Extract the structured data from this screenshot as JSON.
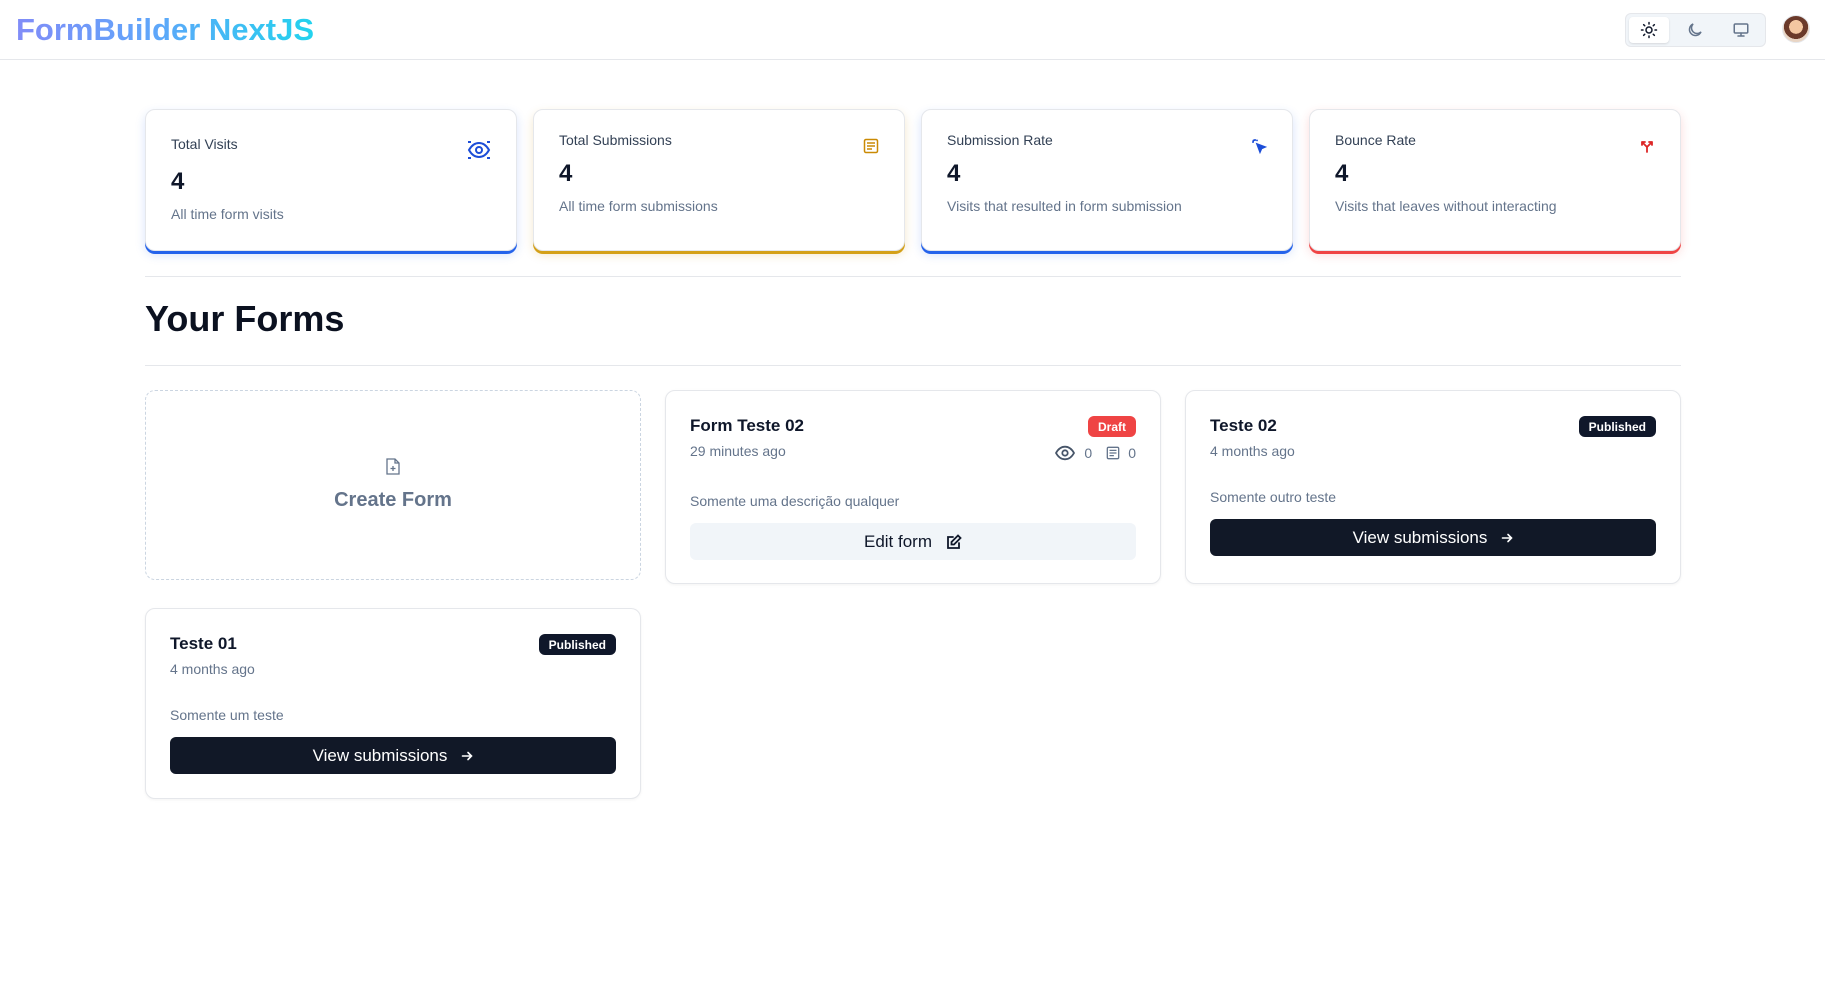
{
  "header": {
    "logo": "FormBuilder NextJS",
    "theme_options": [
      "light-theme",
      "dark-theme",
      "system-theme"
    ]
  },
  "stats": [
    {
      "title": "Total Visits",
      "value": "4",
      "helper": "All time form visits",
      "icon": "eye-icon",
      "color": "#2563eb"
    },
    {
      "title": "Total Submissions",
      "value": "4",
      "helper": "All time form submissions",
      "icon": "form-icon",
      "color": "#ca8a04"
    },
    {
      "title": "Submission Rate",
      "value": "4",
      "helper": "Visits that resulted in form submission",
      "icon": "cursor-click-icon",
      "color": "#2563eb"
    },
    {
      "title": "Bounce Rate",
      "value": "4",
      "helper": "Visits that leaves without interacting",
      "icon": "split-arrow-icon",
      "color": "#dc2626"
    }
  ],
  "section": {
    "title": "Your Forms"
  },
  "create_card": {
    "label": "Create Form"
  },
  "forms": [
    {
      "name": "Form Teste 02",
      "time": "29 minutes ago",
      "status": "Draft",
      "visits": "0",
      "submissions": "0",
      "description": "Somente uma descrição qualquer",
      "action": "Edit form"
    },
    {
      "name": "Teste 02",
      "time": "4 months ago",
      "status": "Published",
      "description": "Somente outro teste",
      "action": "View submissions"
    },
    {
      "name": "Teste 01",
      "time": "4 months ago",
      "status": "Published",
      "description": "Somente um teste",
      "action": "View submissions"
    }
  ]
}
